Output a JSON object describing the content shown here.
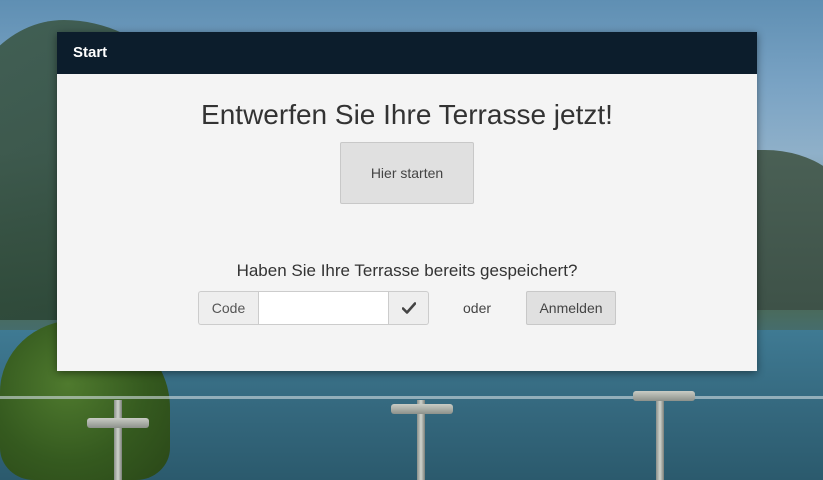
{
  "dialog": {
    "title": "Start",
    "headline": "Entwerfen Sie Ihre Terrasse jetzt!",
    "start_button": "Hier starten",
    "saved_question": "Haben Sie Ihre Terrasse bereits gespeichert?",
    "code_label": "Code",
    "code_value": "",
    "code_submit_icon": "check-icon",
    "or_text": "oder",
    "login_button": "Anmelden"
  },
  "colors": {
    "header_bg": "#0c1d2c",
    "dialog_bg": "#f4f4f4",
    "button_bg": "#e0e0e0"
  }
}
